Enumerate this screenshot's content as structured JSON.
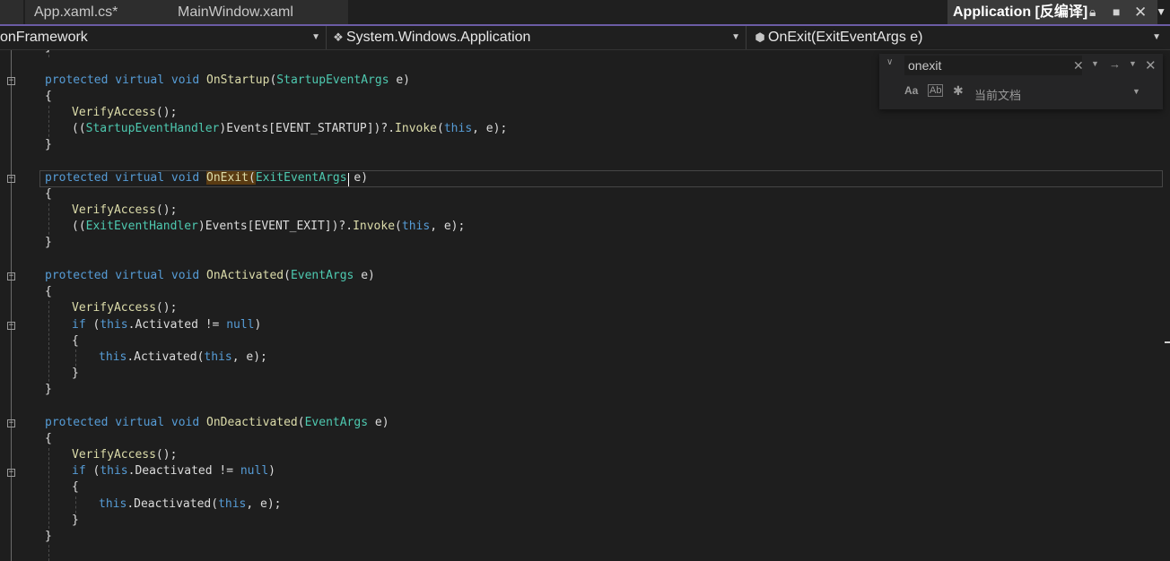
{
  "tabs": [
    {
      "label": "App.xaml.cs*"
    },
    {
      "label": "MainWindow.xaml"
    },
    {
      "label": "Application [反编译]"
    }
  ],
  "icons": {
    "lock": "lock-icon",
    "pin": "pin-icon",
    "close": "close-icon",
    "dropdown": "chevron-down-icon"
  },
  "navbar": {
    "project": "onFramework",
    "type": "System.Windows.Application",
    "member": "OnExit(ExitEventArgs e)"
  },
  "find": {
    "query": "onexit",
    "scope": "当前文档",
    "match_case": "Aa",
    "whole_word": "Ab"
  },
  "code": {
    "top_brace": "}",
    "startup": {
      "mods": "protected virtual void ",
      "name": "OnStartup",
      "open": "(",
      "ptype": "StartupEventArgs",
      "pname": " e)",
      "brace_open": "{",
      "verify": "VerifyAccess",
      "verify_tail": "();",
      "l2_open": "((",
      "handler": "StartupEventHandler",
      "l2_mid": ")Events[EVENT_STARTUP])?.",
      "invoke": "Invoke",
      "l2_paren": "(",
      "this_kw": "this",
      "l2_end": ", e);",
      "brace_close": "}"
    },
    "exit": {
      "mods": "protected virtual void ",
      "name": "OnExit",
      "open": "(",
      "ptype": "ExitEventArgs",
      "pname": " e)",
      "brace_open": "{",
      "verify": "VerifyAccess",
      "verify_tail": "();",
      "l2_open": "((",
      "handler": "ExitEventHandler",
      "l2_mid": ")Events[EVENT_EXIT])?.",
      "invoke": "Invoke",
      "l2_paren": "(",
      "this_kw": "this",
      "l2_end": ", e);",
      "brace_close": "}"
    },
    "activated": {
      "mods": "protected virtual void ",
      "name": "OnActivated",
      "open": "(",
      "ptype": "EventArgs",
      "pname": " e)",
      "brace_open": "{",
      "verify": "VerifyAccess",
      "verify_tail": "();",
      "if_kw": "if",
      "if_open": " (",
      "this_kw": "this",
      "member": ".Activated != ",
      "null_kw": "null",
      "if_close": ")",
      "inner_open": "{",
      "call_tail_a": ".Activated(",
      "call_tail_b": ", e);",
      "inner_close": "}",
      "brace_close": "}"
    },
    "deactivated": {
      "mods": "protected virtual void ",
      "name": "OnDeactivated",
      "open": "(",
      "ptype": "EventArgs",
      "pname": " e)",
      "brace_open": "{",
      "verify": "VerifyAccess",
      "verify_tail": "();",
      "if_kw": "if",
      "if_open": " (",
      "this_kw": "this",
      "member": ".Deactivated != ",
      "null_kw": "null",
      "if_close": ")",
      "inner_open": "{",
      "call_tail_a": ".Deactivated(",
      "call_tail_b": ", e);",
      "inner_close": "}",
      "brace_close": "}"
    }
  }
}
